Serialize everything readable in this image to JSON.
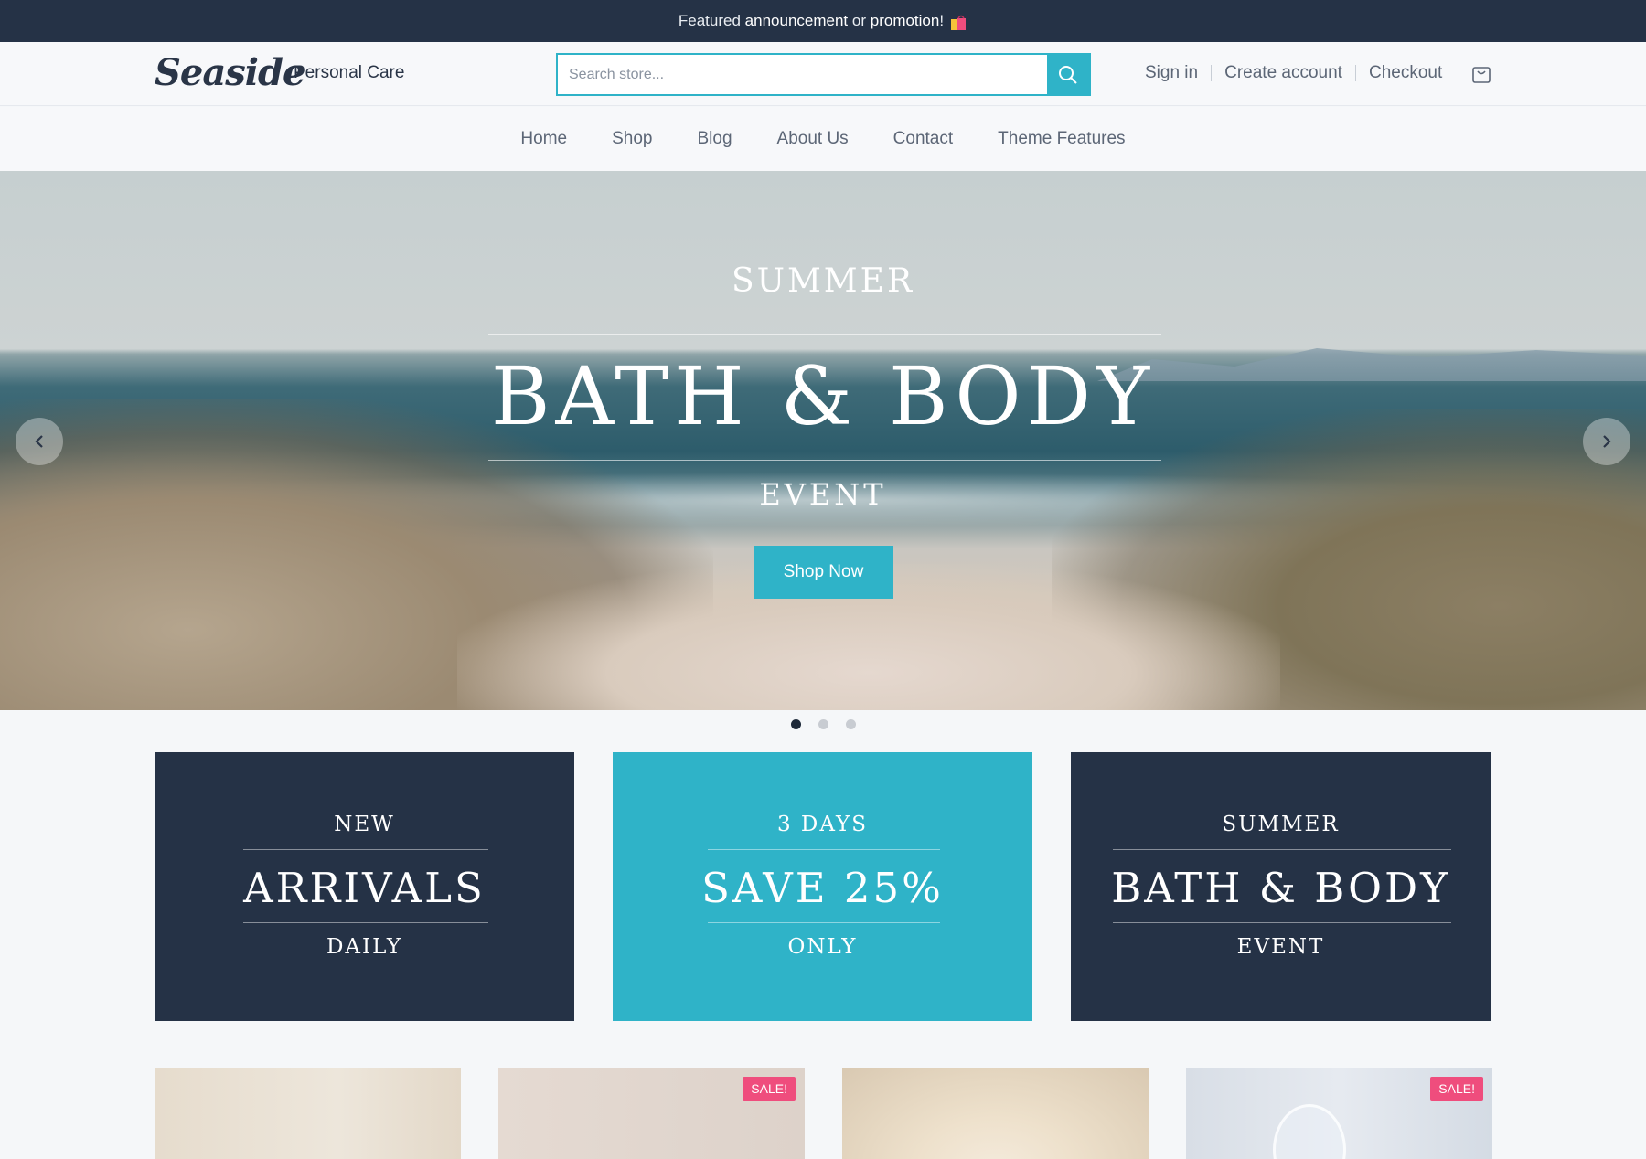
{
  "announcement": {
    "prefix": "Featured ",
    "link1": "announcement",
    "mid": " or ",
    "link2": "promotion",
    "suffix": "!",
    "icon": "shopping-bags-icon"
  },
  "header": {
    "logo": "Seaside",
    "tagline": "Personal Care",
    "search_placeholder": "Search store...",
    "sign_in": "Sign in",
    "create_account": "Create account",
    "checkout": "Checkout",
    "cart_icon": "shopping-cart-icon"
  },
  "nav": {
    "items": [
      "Home",
      "Shop",
      "Blog",
      "About Us",
      "Contact",
      "Theme Features"
    ]
  },
  "hero": {
    "eyebrow": "SUMMER",
    "title": "BATH & BODY",
    "subtitle": "EVENT",
    "button": "Shop Now",
    "active_slide": 1,
    "slide_count": 3
  },
  "tiles": [
    {
      "top": "NEW",
      "main": "ARRIVALS",
      "bottom": "DAILY",
      "color": "#253246"
    },
    {
      "top": "3 DAYS",
      "main": "SAVE 25%",
      "bottom": "ONLY",
      "color": "#2fb3c8"
    },
    {
      "top": "SUMMER",
      "main": "BATH & BODY",
      "bottom": "EVENT",
      "color": "#253246"
    }
  ],
  "products": [
    {
      "sale": ""
    },
    {
      "sale": "SALE!"
    },
    {
      "sale": ""
    },
    {
      "sale": "SALE!"
    }
  ],
  "colors": {
    "accent": "#2fb3c8",
    "dark": "#253246",
    "sale": "#ef4d7d"
  }
}
